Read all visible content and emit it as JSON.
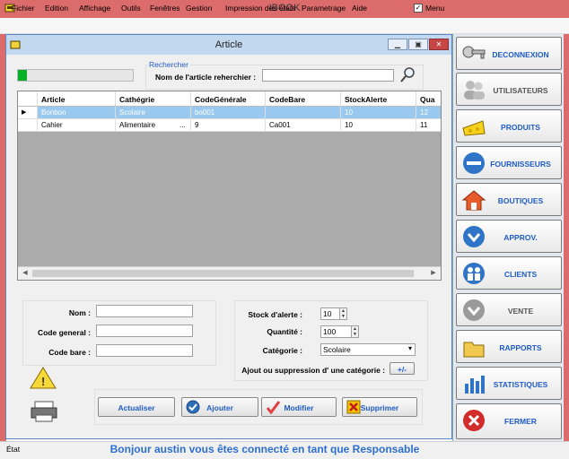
{
  "app": {
    "title": "IBOOK"
  },
  "menu": {
    "items": [
      "Fichier",
      "Edition",
      "Affichage",
      "Outils",
      "Fenêtres",
      "Gestion",
      "Impression des états",
      "Parametrage",
      "Aide"
    ],
    "checkbox_label": "Menu",
    "checkbox_checked": true
  },
  "article_window": {
    "title": "Article",
    "progress_percent": 8,
    "search": {
      "group_label": "Rechercher",
      "label": "Nom de l'article reherchier :",
      "value": ""
    },
    "grid": {
      "columns": [
        "Article",
        "Cathégrie",
        "CodeGénérale",
        "CodeBare",
        "StockAlerte",
        "Qua"
      ],
      "rows": [
        [
          "Bonbon",
          "Scolaire",
          "bo001",
          "",
          "10",
          "12"
        ],
        [
          "Cahier",
          "Alimentaire",
          "9",
          "Ca001",
          "10",
          "11"
        ]
      ],
      "row_extra": [
        "",
        "..."
      ]
    },
    "form": {
      "nom_label": "Nom :",
      "code_general_label": "Code general :",
      "code_bare_label": "Code bare :",
      "stock_label": "Stock d'alerte :",
      "stock_value": "10",
      "quantite_label": "Quantité :",
      "quantite_value": "100",
      "categorie_label": "Catégorie :",
      "categorie_value": "Scolaire",
      "categorie_toggle_label": "Ajout ou suppression d' une catégorie :",
      "categorie_toggle_button": "+/-"
    },
    "buttons": {
      "actualiser": "Actualiser",
      "ajouter": "Ajouter",
      "modifier": "Modifier",
      "supprimer": "Supprimer"
    }
  },
  "sidebar": {
    "items": [
      {
        "label": "DECONNEXION",
        "icon": "keys-icon"
      },
      {
        "label": "UTILISATEURS",
        "icon": "users-icon"
      },
      {
        "label": "PRODUITS",
        "icon": "cheese-icon"
      },
      {
        "label": "FOURNISSEURS",
        "icon": "ship-icon"
      },
      {
        "label": "BOUTIQUES",
        "icon": "house-icon"
      },
      {
        "label": "APPROV.",
        "icon": "down-arrow-icon"
      },
      {
        "label": "CLIENTS",
        "icon": "clients-icon"
      },
      {
        "label": "VENTE",
        "icon": "down-arrow-icon"
      },
      {
        "label": "RAPPORTS",
        "icon": "folder-icon"
      },
      {
        "label": "STATISTIQUES",
        "icon": "chart-icon"
      },
      {
        "label": "FERMER",
        "icon": "close-icon"
      }
    ]
  },
  "status": {
    "left": "État",
    "message": "Bonjour austin vous êtes connecté en tant que Responsable"
  },
  "colors": {
    "title_bar": "#dc6b6b",
    "accent": "#1f5cc6",
    "selected_row": "#99c9ef"
  }
}
